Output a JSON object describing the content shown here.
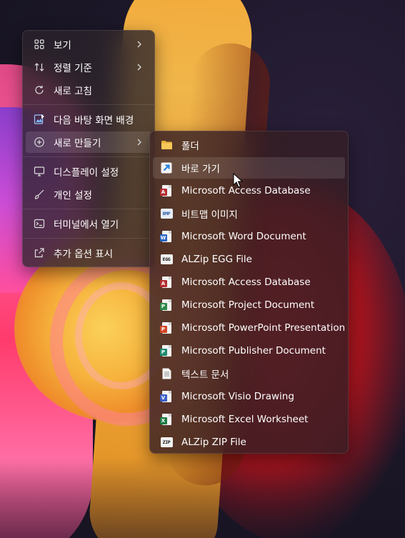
{
  "colors": {
    "menu_bg": "#2c242c",
    "submenu_bg": "#341e24",
    "hover": "#ffffff1c",
    "folder": "#f2c14e",
    "shortcut": "#2f8fe8",
    "access": "#c0392b",
    "word": "#2b65c2",
    "project": "#2f8a4a",
    "powerpoint": "#d24726",
    "publisher": "#1f8a70",
    "visio": "#3a5fc4",
    "excel": "#1e7a45"
  },
  "main_menu": {
    "items": [
      {
        "label": "보기",
        "icon": "grid-icon",
        "has_submenu": true
      },
      {
        "label": "정렬 기준",
        "icon": "sort-icon",
        "has_submenu": true
      },
      {
        "label": "새로 고침",
        "icon": "refresh-icon",
        "has_submenu": false
      },
      {
        "label": "다음 바탕 화면 배경",
        "icon": "next-background-icon",
        "has_submenu": false
      },
      {
        "label": "새로 만들기",
        "icon": "new-plus-icon",
        "has_submenu": true,
        "active": true
      },
      {
        "label": "디스플레이 설정",
        "icon": "display-icon",
        "has_submenu": false
      },
      {
        "label": "개인 설정",
        "icon": "brush-icon",
        "has_submenu": false
      },
      {
        "label": "터미널에서 열기",
        "icon": "terminal-icon",
        "has_submenu": false
      },
      {
        "label": "추가 옵션 표시",
        "icon": "more-options-icon",
        "has_submenu": false
      }
    ]
  },
  "sub_menu": {
    "items": [
      {
        "label": "폴더",
        "icon": "folder-icon"
      },
      {
        "label": "바로 가기",
        "icon": "shortcut-icon",
        "hovered": true
      },
      {
        "label": "Microsoft Access Database",
        "icon": "access-icon"
      },
      {
        "label": "비트맵 이미지",
        "icon": "bitmap-icon",
        "icon_text": "BMP"
      },
      {
        "label": "Microsoft Word Document",
        "icon": "word-icon"
      },
      {
        "label": "ALZip EGG File",
        "icon": "egg-icon",
        "icon_text": "EGG"
      },
      {
        "label": "Microsoft Access Database",
        "icon": "access-icon"
      },
      {
        "label": "Microsoft Project Document",
        "icon": "project-icon"
      },
      {
        "label": "Microsoft PowerPoint Presentation",
        "icon": "powerpoint-icon"
      },
      {
        "label": "Microsoft Publisher Document",
        "icon": "publisher-icon"
      },
      {
        "label": "텍스트 문서",
        "icon": "text-document-icon"
      },
      {
        "label": "Microsoft Visio Drawing",
        "icon": "visio-icon"
      },
      {
        "label": "Microsoft Excel Worksheet",
        "icon": "excel-icon"
      },
      {
        "label": "ALZip ZIP File",
        "icon": "zip-icon",
        "icon_text": "ZIP"
      }
    ]
  }
}
